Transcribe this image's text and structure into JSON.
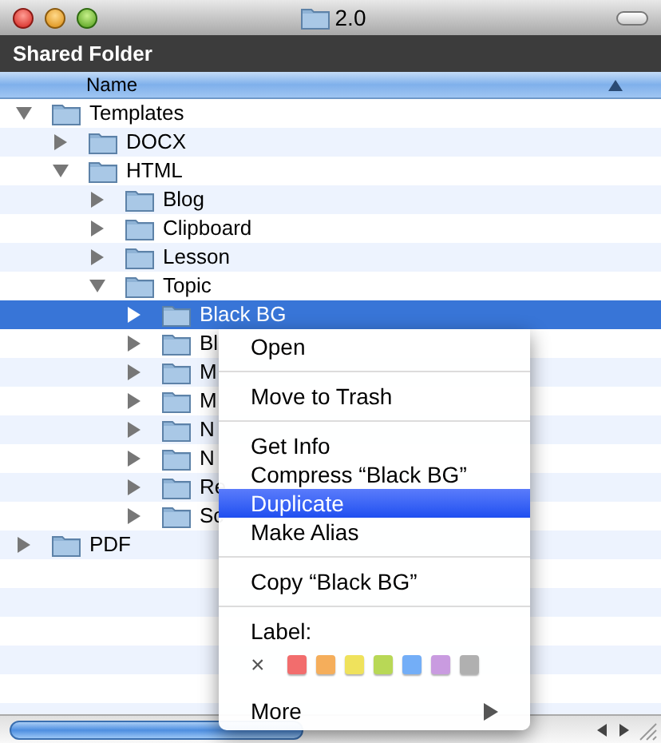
{
  "window": {
    "title": "2.0"
  },
  "header": {
    "title": "Shared Folder"
  },
  "columns": [
    {
      "label": "Name",
      "sort_ascending": true
    }
  ],
  "tree": [
    {
      "name": "Templates",
      "expanded": true,
      "selected": false,
      "children": [
        {
          "name": "DOCX",
          "expanded": false,
          "selected": false
        },
        {
          "name": "HTML",
          "expanded": true,
          "selected": false,
          "children": [
            {
              "name": "Blog",
              "expanded": false,
              "selected": false
            },
            {
              "name": "Clipboard",
              "expanded": false,
              "selected": false
            },
            {
              "name": "Lesson",
              "expanded": false,
              "selected": false
            },
            {
              "name": "Topic",
              "expanded": true,
              "selected": false,
              "children": [
                {
                  "name": "Black BG",
                  "expanded": false,
                  "selected": true
                },
                {
                  "name": "Bl",
                  "expanded": false,
                  "selected": false
                },
                {
                  "name": "M",
                  "expanded": false,
                  "selected": false
                },
                {
                  "name": "M",
                  "expanded": false,
                  "selected": false
                },
                {
                  "name": "N",
                  "expanded": false,
                  "selected": false
                },
                {
                  "name": "N",
                  "expanded": false,
                  "selected": false
                },
                {
                  "name": "Re",
                  "expanded": false,
                  "selected": false
                },
                {
                  "name": "Sc",
                  "expanded": false,
                  "selected": false
                }
              ]
            }
          ]
        }
      ]
    },
    {
      "name": "PDF",
      "expanded": false,
      "selected": false
    }
  ],
  "context_menu": [
    {
      "kind": "item",
      "label": "Open",
      "selected": false
    },
    {
      "kind": "separator"
    },
    {
      "kind": "item",
      "label": "Move to Trash",
      "selected": false
    },
    {
      "kind": "separator"
    },
    {
      "kind": "item",
      "label": "Get Info",
      "selected": false
    },
    {
      "kind": "item",
      "label": "Compress “Black BG”",
      "selected": false
    },
    {
      "kind": "item",
      "label": "Duplicate",
      "selected": true
    },
    {
      "kind": "item",
      "label": "Make Alias",
      "selected": false
    },
    {
      "kind": "separator"
    },
    {
      "kind": "item",
      "label": "Copy “Black BG”",
      "selected": false
    },
    {
      "kind": "separator"
    },
    {
      "kind": "heading",
      "label": "Label:"
    },
    {
      "kind": "labels",
      "clear": "×",
      "colors": [
        {
          "color": "#f26d6d"
        },
        {
          "color": "#f5ae5b"
        },
        {
          "color": "#efe25c"
        },
        {
          "color": "#b8d856"
        },
        {
          "color": "#73aef7"
        },
        {
          "color": "#c99be0"
        },
        {
          "color": "#b0b0b0"
        }
      ]
    },
    {
      "kind": "submenu",
      "label": "More",
      "selected": false
    }
  ]
}
